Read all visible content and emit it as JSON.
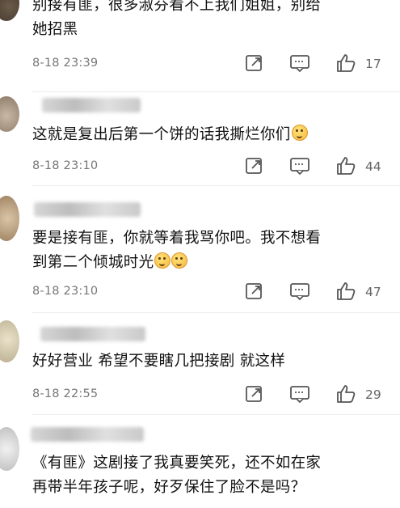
{
  "comments": [
    {
      "text_line1": "别接有匪，很多淑芬看不上我们姐姐，别给",
      "text_line2": "她招黑",
      "timestamp": "8-18 23:39",
      "likes": "17"
    },
    {
      "text": "这就是复出后第一个饼的话我撕烂你们",
      "timestamp": "8-18 23:10",
      "likes": "44"
    },
    {
      "text_line1": "要是接有匪，你就等着我骂你吧。我不想看",
      "text_line2": "到第二个倾城时光",
      "timestamp": "8-18 23:10",
      "likes": "47"
    },
    {
      "text": "好好营业 希望不要瞎几把接剧 就这样",
      "timestamp": "8-18 22:55",
      "likes": "29"
    },
    {
      "text_line1": "《有匪》这剧接了我真要笑死，还不如在家",
      "text_line2": "再带半年孩子呢，好歹保住了脸不是吗？"
    }
  ],
  "icons": {
    "share": "share-icon",
    "comment": "comment-icon",
    "like": "like-icon",
    "emoji": "grinning-emoji-icon"
  },
  "colors": {
    "text": "#111111",
    "meta": "#777777",
    "icon": "#555555"
  }
}
